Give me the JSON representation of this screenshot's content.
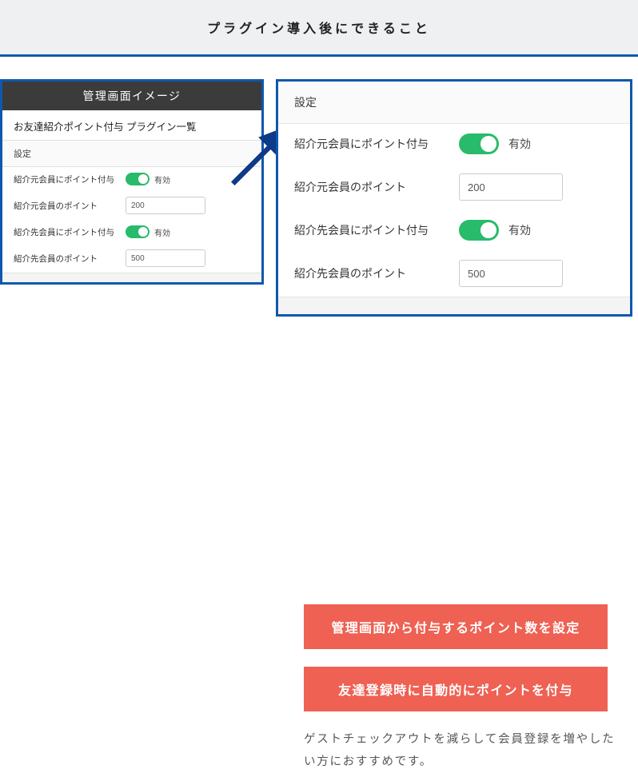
{
  "header": {
    "title": "プラグイン導入後にできること"
  },
  "small_panel": {
    "title": "管理画面イメージ",
    "breadcrumb": "お友達紹介ポイント付与 プラグイン一覧",
    "section": "設定",
    "rows": {
      "referrer_grant_label": "紹介元会員にポイント付与",
      "referrer_grant_status": "有効",
      "referrer_points_label": "紹介元会員のポイント",
      "referrer_points_value": "200",
      "referee_grant_label": "紹介先会員にポイント付与",
      "referee_grant_status": "有効",
      "referee_points_label": "紹介先会員のポイント",
      "referee_points_value": "500"
    }
  },
  "large_panel": {
    "section": "設定",
    "rows": {
      "referrer_grant_label": "紹介元会員にポイント付与",
      "referrer_grant_status": "有効",
      "referrer_points_label": "紹介元会員のポイント",
      "referrer_points_value": "200",
      "referee_grant_label": "紹介先会員にポイント付与",
      "referee_grant_status": "有効",
      "referee_points_label": "紹介先会員のポイント",
      "referee_points_value": "500"
    }
  },
  "callouts": {
    "c1": "管理画面から付与するポイント数を設定",
    "c2": "友達登録時に自動的にポイントを付与"
  },
  "description": "ゲストチェックアウトを減らして会員登録を増やしたい方におすすめです。"
}
